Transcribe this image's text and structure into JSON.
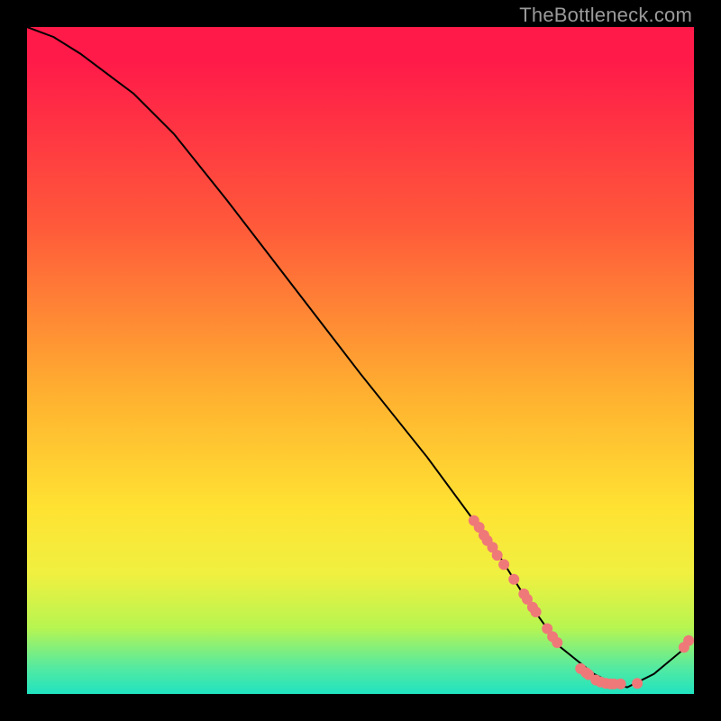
{
  "watermark": "TheBottleneck.com",
  "colors": {
    "line": "#000000",
    "point_fill": "#ef7979",
    "point_stroke": "#ef7979"
  },
  "chart_data": {
    "type": "line",
    "title": "",
    "xlabel": "",
    "ylabel": "",
    "xlim": [
      0,
      100
    ],
    "ylim": [
      0,
      100
    ],
    "series": [
      {
        "name": "bottleneck-curve",
        "x": [
          0,
          4,
          8,
          12,
          16,
          22,
          30,
          40,
          50,
          60,
          67,
          70,
          75,
          80,
          85,
          88,
          90,
          94,
          100
        ],
        "y": [
          100,
          98.5,
          96,
          93,
          90,
          84,
          74,
          61,
          48,
          35.5,
          26,
          22,
          14,
          7,
          3,
          1.5,
          1,
          3,
          8
        ]
      }
    ],
    "points": [
      {
        "name": "dot-1",
        "x": 67,
        "y": 26
      },
      {
        "name": "dot-2",
        "x": 67.8,
        "y": 25
      },
      {
        "name": "dot-3",
        "x": 68.5,
        "y": 23.8
      },
      {
        "name": "dot-4",
        "x": 69,
        "y": 23
      },
      {
        "name": "dot-5",
        "x": 69.8,
        "y": 22
      },
      {
        "name": "dot-6",
        "x": 70.5,
        "y": 20.8
      },
      {
        "name": "dot-7",
        "x": 71.5,
        "y": 19.4
      },
      {
        "name": "dot-8",
        "x": 73,
        "y": 17.2
      },
      {
        "name": "dot-9",
        "x": 74.5,
        "y": 15
      },
      {
        "name": "dot-10",
        "x": 75,
        "y": 14.2
      },
      {
        "name": "dot-11",
        "x": 75.8,
        "y": 13
      },
      {
        "name": "dot-12",
        "x": 76.3,
        "y": 12.3
      },
      {
        "name": "dot-13",
        "x": 78,
        "y": 9.8
      },
      {
        "name": "dot-14",
        "x": 78.8,
        "y": 8.6
      },
      {
        "name": "dot-15",
        "x": 79.5,
        "y": 7.7
      },
      {
        "name": "dot-16",
        "x": 83,
        "y": 3.8
      },
      {
        "name": "dot-17",
        "x": 83.8,
        "y": 3.2
      },
      {
        "name": "dot-18",
        "x": 84.2,
        "y": 2.9
      },
      {
        "name": "dot-19",
        "x": 85.3,
        "y": 2.1
      },
      {
        "name": "dot-20",
        "x": 86,
        "y": 1.8
      },
      {
        "name": "dot-21",
        "x": 86.8,
        "y": 1.6
      },
      {
        "name": "dot-22",
        "x": 87.5,
        "y": 1.5
      },
      {
        "name": "dot-23",
        "x": 88,
        "y": 1.5
      },
      {
        "name": "dot-24",
        "x": 89,
        "y": 1.5
      },
      {
        "name": "dot-25",
        "x": 91.5,
        "y": 1.6
      },
      {
        "name": "dot-26",
        "x": 98.5,
        "y": 7
      },
      {
        "name": "dot-27",
        "x": 99.2,
        "y": 8
      }
    ]
  }
}
